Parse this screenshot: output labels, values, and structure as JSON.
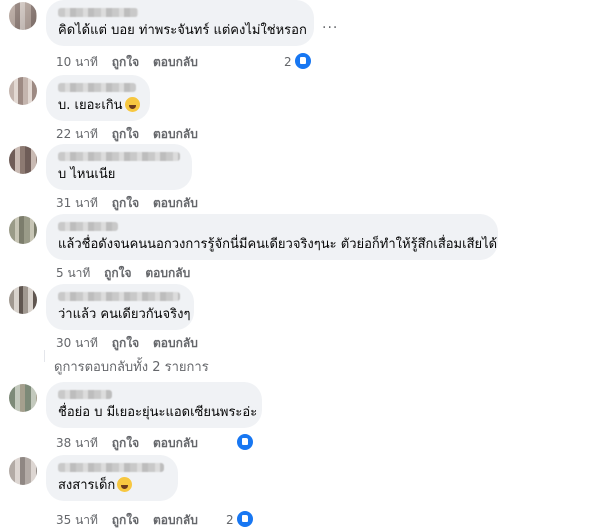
{
  "comments": [
    {
      "text": "คิดได้แต่ บอย ท่าพระจันทร์ แต่คงไม่ใช่หรอก",
      "time": "10 นาที",
      "like": "ถูกใจ",
      "reply": "ตอบกลับ",
      "reactions": "2"
    },
    {
      "text": "บ. เยอะเกิน",
      "time": "22 นาที",
      "like": "ถูกใจ",
      "reply": "ตอบกลับ"
    },
    {
      "text": "บ ไหนเนีย",
      "time": "31 นาที",
      "like": "ถูกใจ",
      "reply": "ตอบกลับ"
    },
    {
      "text": "แล้วชื่อดังจนคนนอกวงการรู้จักนี่มีคนเดียวจริงๆนะ ตัวย่อก็ทำให้รู้สึกเสื่อมเสียได้",
      "time": "5 นาที",
      "like": "ถูกใจ",
      "reply": "ตอบกลับ"
    },
    {
      "text": "ว่าแล้ว คนเดียวกันจริงๆ",
      "time": "30 นาที",
      "like": "ถูกใจ",
      "reply": "ตอบกลับ"
    },
    {
      "text": "ชื่อย่อ บ มีเยอะยุ่นะแอดเซียนพระอ่ะ",
      "time": "38 นาที",
      "like": "ถูกใจ",
      "reply": "ตอบกลับ",
      "reactions": "1"
    },
    {
      "text": "สงสารเด็ก",
      "time": "35 นาที",
      "like": "ถูกใจ",
      "reply": "ตอบกลับ",
      "reactions": "2"
    }
  ],
  "view_replies": "ดูการตอบกลับทั้ง 2 รายการ",
  "more_label": "...",
  "icons": {
    "like_reaction": "like-icon",
    "emoji": "laughing-emoji",
    "more": "ellipsis-icon"
  },
  "colors": {
    "bubble": "#f0f2f5",
    "meta": "#65676b",
    "like_blue": "#1877f2"
  }
}
